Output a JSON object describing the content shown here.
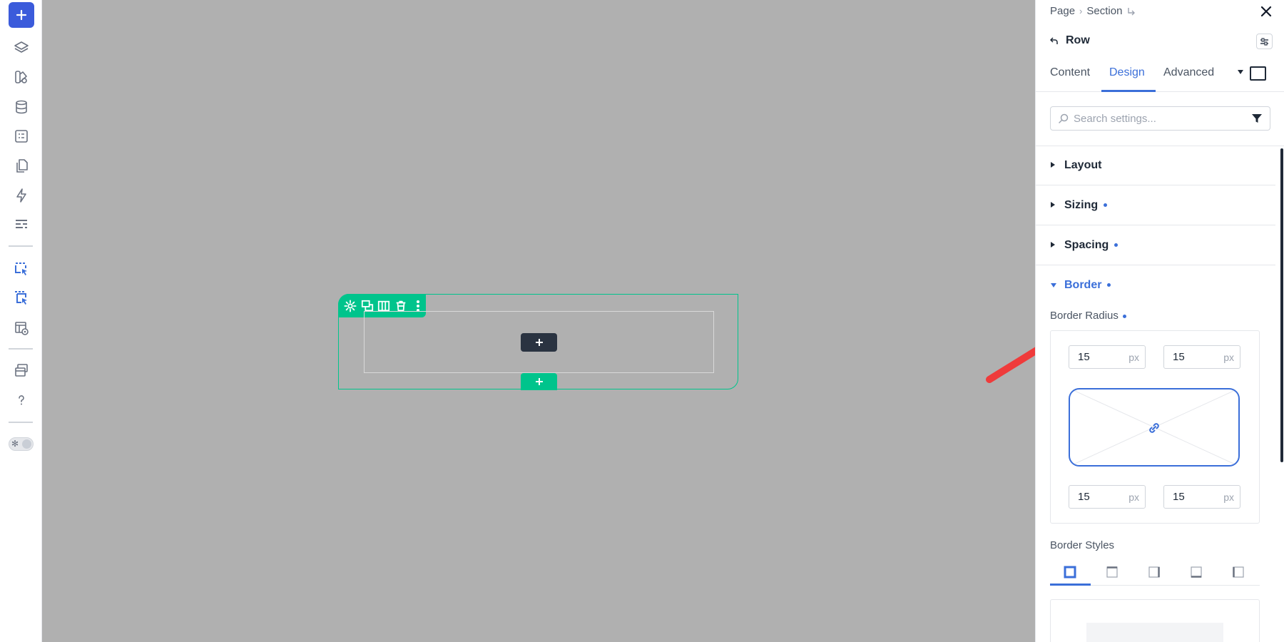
{
  "breadcrumb": {
    "page": "Page",
    "section": "Section"
  },
  "panel": {
    "element_title": "Row",
    "tabs": {
      "content": "Content",
      "design": "Design",
      "advanced": "Advanced"
    },
    "search": {
      "placeholder": "Search settings..."
    },
    "sections": {
      "layout": "Layout",
      "sizing": "Sizing",
      "spacing": "Spacing",
      "border": "Border"
    },
    "border_radius": {
      "label": "Border Radius",
      "top_left": "15",
      "top_right": "15",
      "bottom_left": "15",
      "bottom_right": "15",
      "unit": "px"
    },
    "border_styles": {
      "label": "Border Styles"
    }
  },
  "canvas": {
    "add_symbol": "+"
  },
  "colors": {
    "accent": "#3b6fd9",
    "selection": "#00c48c",
    "canvas_bg": "#b0b0b0",
    "annotation_arrow": "#ef3b3b"
  }
}
